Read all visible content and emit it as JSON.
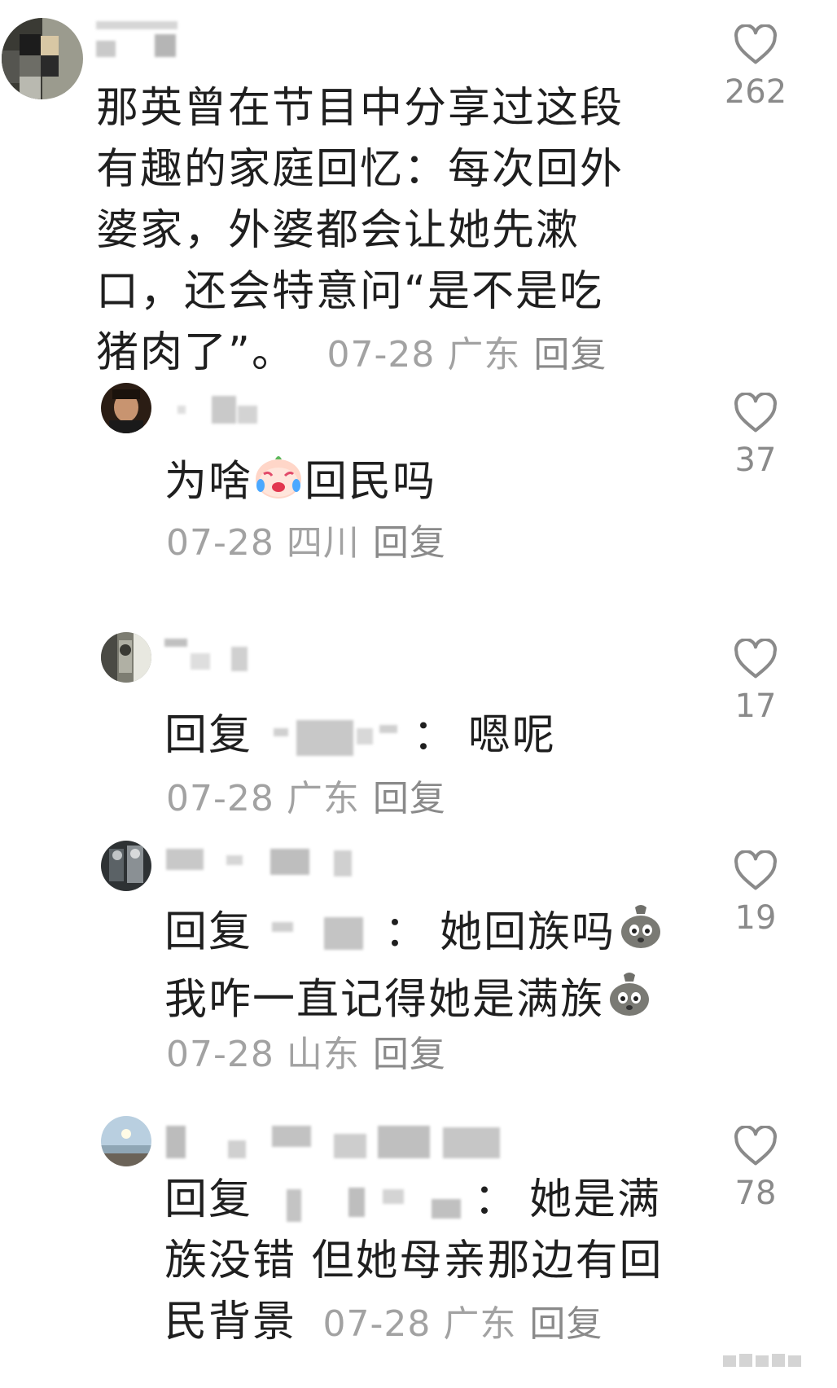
{
  "comments": [
    {
      "text": "那英曾在节目中分享过这段有趣的家庭回忆：每次回外婆家，外婆都会让她先漱口，还会特意问“是不是吃猪肉了”。",
      "date": "07-28",
      "location": "广东",
      "reply_label": "回复",
      "likes": "262"
    },
    {
      "text_before": "为啥",
      "emoji": "crying-emoji",
      "text_after": "回民吗",
      "date": "07-28",
      "location": "四川",
      "reply_label": "回复",
      "likes": "37"
    },
    {
      "reply_prefix": "回复",
      "colon": "：",
      "text": "嗯呢",
      "date": "07-28",
      "location": "广东",
      "reply_label": "回复",
      "likes": "17"
    },
    {
      "reply_prefix": "回复",
      "colon": "：",
      "text_line1": "她回族吗",
      "text_line2": "我咋一直记得她是满族",
      "emoji": "sack-face-emoji",
      "date": "07-28",
      "location": "山东",
      "reply_label": "回复",
      "likes": "19"
    },
    {
      "reply_prefix": "回复",
      "colon": "：",
      "text_line1": "她是满",
      "text_line2": "族没错 但她母亲那边有回",
      "text_line3": "民背景",
      "date": "07-28",
      "location": "广东",
      "reply_label": "回复",
      "likes": "78"
    }
  ],
  "colors": {
    "text": "#1f1f1f",
    "meta": "#a2a2a2",
    "heart": "#8a8a8a",
    "background": "#ffffff"
  }
}
